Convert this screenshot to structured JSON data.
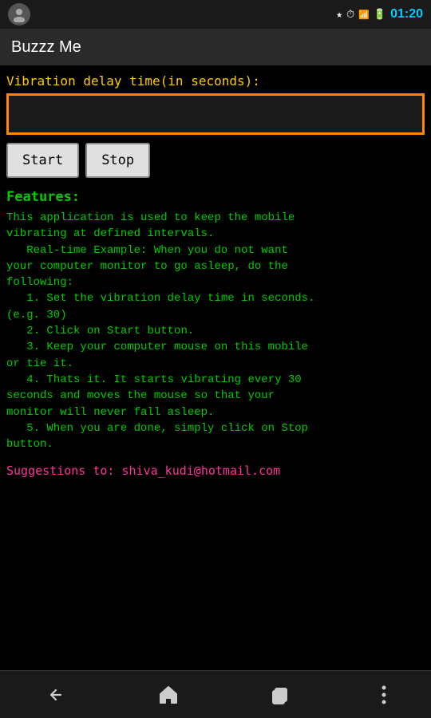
{
  "statusBar": {
    "time": "01:20"
  },
  "titleBar": {
    "title": "Buzzz Me"
  },
  "vibrationLabel": "Vibration delay time(in seconds):",
  "input": {
    "placeholder": "",
    "value": ""
  },
  "buttons": {
    "start": "Start",
    "stop": "Stop"
  },
  "featuresHeader": "Features:",
  "featuresText": "This application is used to keep the mobile\nvibrating at defined intervals.\n   Real-time Example: When you do not want\nyour computer monitor to go asleep, do the\nfollowing:\n   1. Set the vibration delay time in seconds.\n(e.g. 30)\n   2. Click on Start button.\n   3. Keep your computer mouse on this mobile\nor tie it.\n   4. Thats it. It starts vibrating every 30\nseconds and moves the mouse so that your\nmonitor will never fall asleep.\n   5. When you are done, simply click on Stop\nbutton.",
  "suggestions": "Suggestions to: shiva_kudi@hotmail.com",
  "nav": {
    "back": "←",
    "home": "⌂",
    "recent": "▭",
    "menu": "⋮"
  }
}
